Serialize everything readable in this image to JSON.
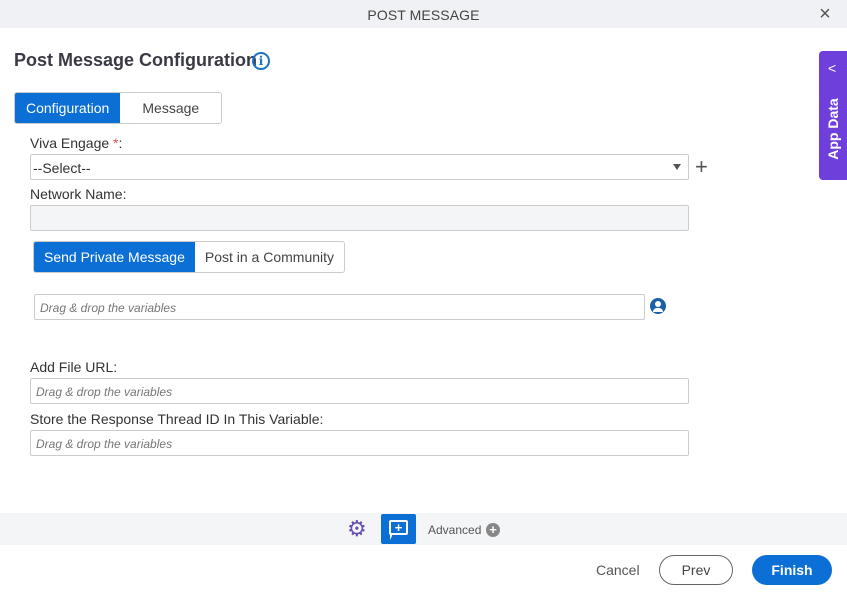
{
  "window": {
    "title": "POST MESSAGE",
    "close_icon": "×"
  },
  "header": {
    "title": "Post Message Configuration",
    "info_icon": "i"
  },
  "tabs": [
    {
      "label": "Configuration",
      "active": true
    },
    {
      "label": "Message",
      "active": false
    }
  ],
  "form": {
    "viva_engage": {
      "label": "Viva Engage ",
      "required": "*",
      "suffix": ":",
      "value": "--Select--"
    },
    "add_icon": "+",
    "network_name": {
      "label": "Network Name:",
      "value": ""
    },
    "message_type_tabs": [
      {
        "label": "Send Private Message",
        "active": true
      },
      {
        "label": "Post in a Community",
        "active": false
      }
    ],
    "recipient": {
      "placeholder": "Drag & drop the variables"
    },
    "file_url": {
      "label": "Add File URL:",
      "placeholder": "Drag & drop the variables"
    },
    "thread_id": {
      "label": "Store the Response Thread ID In This Variable:",
      "placeholder": "Drag & drop the variables"
    }
  },
  "side_panel": {
    "label": "App Data",
    "chevron": "<"
  },
  "advanced_bar": {
    "gear_icon": "⚙",
    "note_icon": "+",
    "label": "Advanced",
    "plus_icon": "+"
  },
  "footer": {
    "cancel": "Cancel",
    "prev": "Prev",
    "finish": "Finish"
  },
  "colors": {
    "primary": "#0b6fd6",
    "side_panel": "#6f3fdb",
    "required": "#d9534f"
  }
}
